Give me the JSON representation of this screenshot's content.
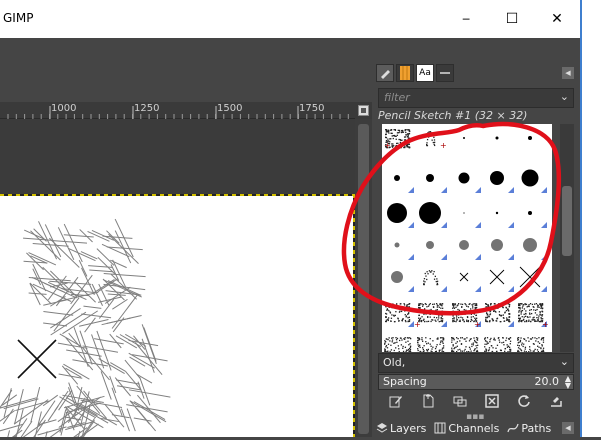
{
  "window": {
    "title": "GIMP",
    "minimize_glyph": "─",
    "maximize_glyph": "☐",
    "close_glyph": "✕"
  },
  "ruler": {
    "labels": [
      "1000",
      "1250",
      "1500",
      "1750"
    ]
  },
  "brushes_panel": {
    "tab_text_label": "Aa",
    "filter_placeholder": "filter",
    "selected_brush": "Pencil Sketch #1 (32 × 32)",
    "tag_selector_value": "Old,",
    "spacing_label": "Spacing",
    "spacing_value": "20.0",
    "accent_color": "#f0a030"
  },
  "dock_tabs": {
    "layers": "Layers",
    "channels": "Channels",
    "paths": "Paths"
  },
  "annotation": {
    "color": "#e0101a"
  }
}
